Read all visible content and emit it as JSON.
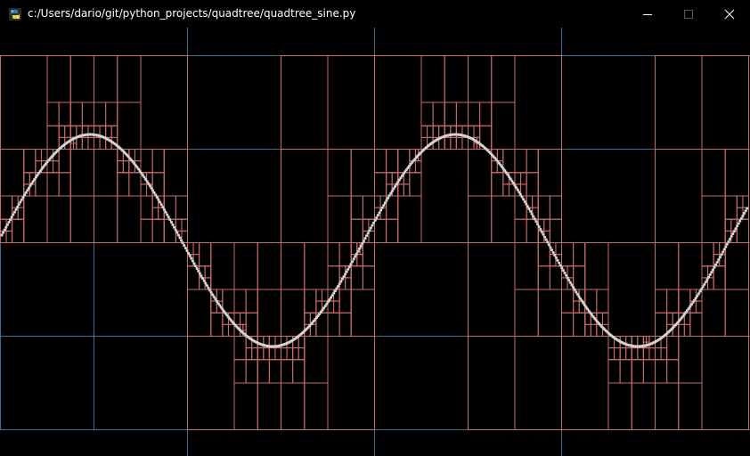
{
  "window": {
    "title": "c:/Users/dario/git/python_projects/quadtree/quadtree_sine.py",
    "icon": "python-icon",
    "controls": [
      "minimize-icon",
      "maximize-icon",
      "close-icon"
    ]
  },
  "colors": {
    "background": "#000000",
    "grid_line": "#3f6e8f",
    "quadtree_line": "#c96c6c",
    "points": "#d2d2d2",
    "title_text": "#ffffff"
  },
  "scene": {
    "description_kind": "quadtree visualization of sine wave points",
    "curve": "sine",
    "periods_visible": 2
  }
}
